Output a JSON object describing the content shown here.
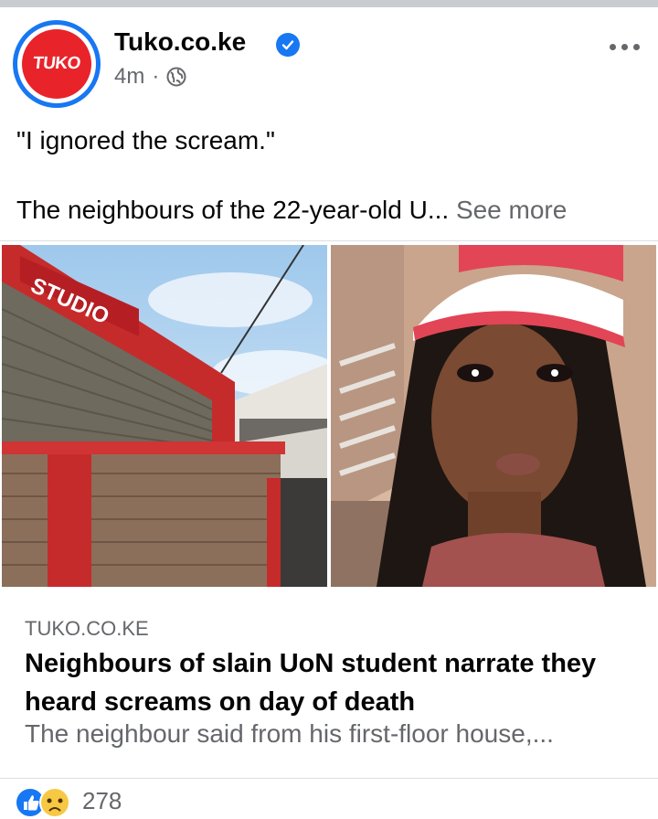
{
  "post": {
    "page_name": "Tuko.co.ke",
    "logo_text": "TUKO",
    "time": "4m",
    "separator": "·",
    "quote": "\"I ignored the scream.\"",
    "body_preview": "The neighbours of the 22-year-old U...",
    "see_more": "See more"
  },
  "images": {
    "left_sign_text": "STUDIO"
  },
  "link": {
    "domain": "TUKO.CO.KE",
    "headline": "Neighbours of slain UoN student narrate they heard screams on day of death",
    "description": "The neighbour said from his first-floor house,..."
  },
  "reactions": {
    "count": "278"
  },
  "colors": {
    "accent": "#1877f2",
    "brand_red": "#e8232a",
    "secondary_text": "#65676b"
  }
}
